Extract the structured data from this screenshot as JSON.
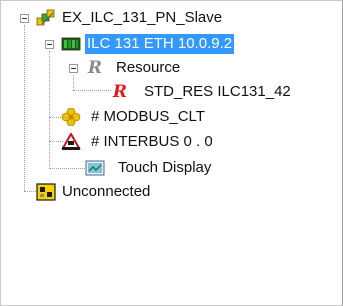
{
  "tree": {
    "root": {
      "label": "EX_ILC_131_PN_Slave",
      "icon": "project-icon",
      "expanded": true
    },
    "controller": {
      "label": "ILC 131 ETH 10.0.9.2",
      "icon": "plc-controller-icon",
      "expanded": true,
      "selected": true
    },
    "resource": {
      "label": "Resource",
      "icon": "resource-r-icon",
      "expanded": true
    },
    "std_res": {
      "label": "STD_RES ILC131_42",
      "icon": "red-r-icon"
    },
    "modbus": {
      "label": "# MODBUS_CLT",
      "icon": "modbus-flower-icon"
    },
    "interbus": {
      "label": "# INTERBUS 0 . 0",
      "icon": "interbus-icon"
    },
    "touch": {
      "label": "Touch Display",
      "icon": "touch-display-icon"
    },
    "unconnected": {
      "label": "Unconnected",
      "icon": "unconnected-device-icon"
    }
  },
  "colors": {
    "selection": "#3399ff",
    "red_r": "#e41b1b",
    "gray_r": "#8a8a8a"
  }
}
